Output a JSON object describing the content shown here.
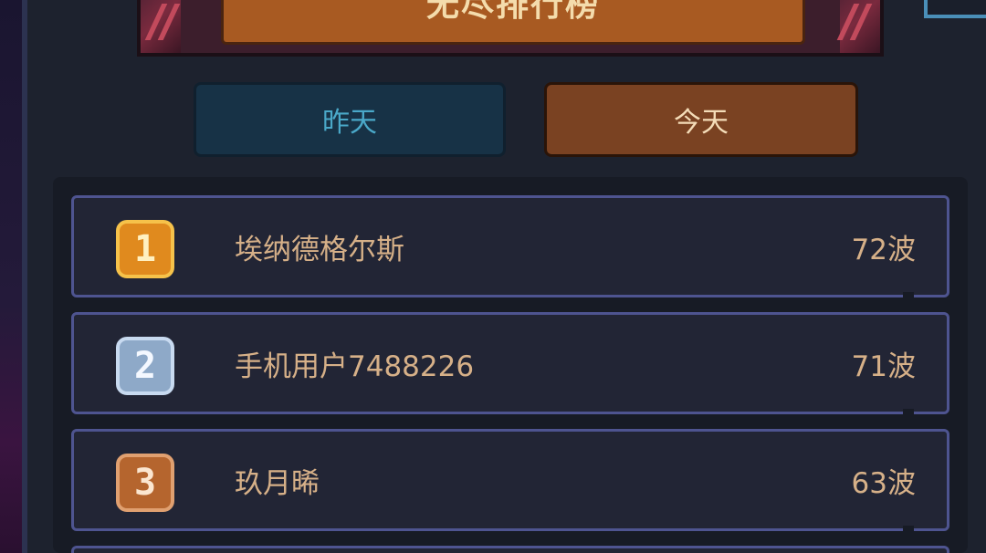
{
  "banner": {
    "title": "无尽排行榜"
  },
  "tabs": {
    "yesterday": "昨天",
    "today": "今天"
  },
  "leaderboard": [
    {
      "rank": "1",
      "medal_icon": "gold-medal-icon",
      "name": "埃纳德格尔斯",
      "wave": "72波"
    },
    {
      "rank": "2",
      "medal_icon": "silver-medal-icon",
      "name": "手机用户7488226",
      "wave": "71波"
    },
    {
      "rank": "3",
      "medal_icon": "bronze-medal-icon",
      "name": "玖月晞",
      "wave": "63波"
    }
  ],
  "colors": {
    "panel": "#1d222e",
    "tab_yesterday": "#173246",
    "tab_today": "#7a4222",
    "row_border": "#4e5490",
    "text_gold": "#d6b088"
  }
}
